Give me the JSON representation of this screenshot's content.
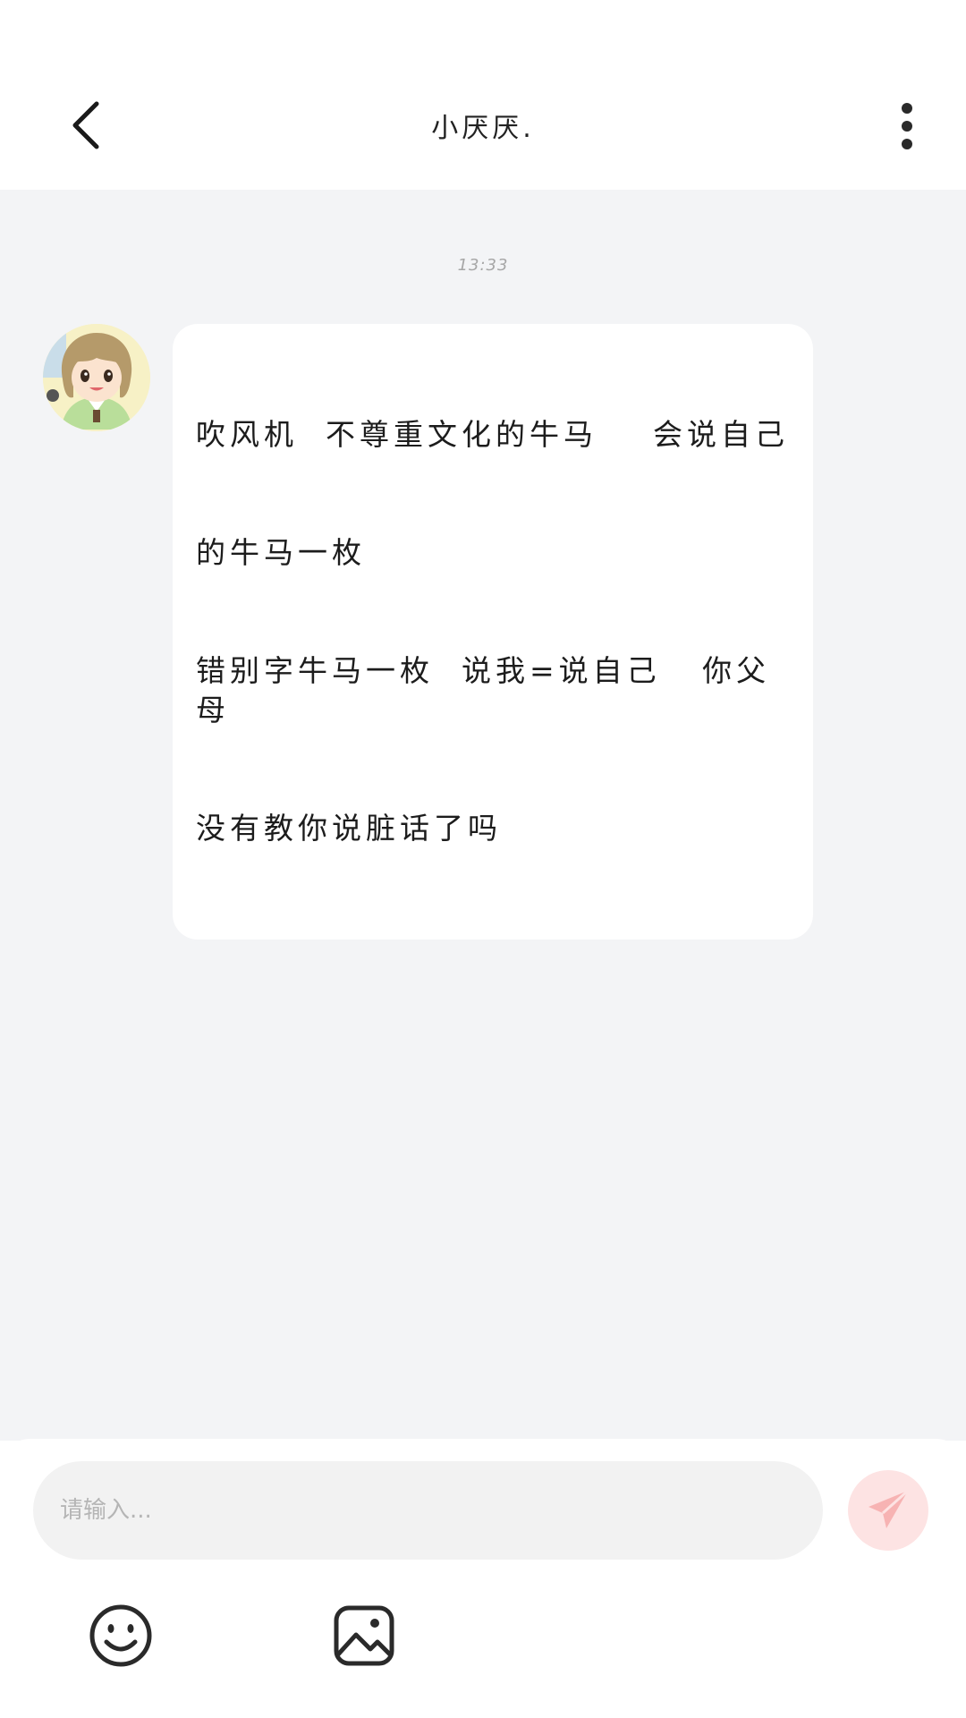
{
  "header": {
    "title": "小厌厌.",
    "back_icon": "chevron-left-icon",
    "more_icon": "more-vertical-icon"
  },
  "chat": {
    "timestamp": "13:33",
    "messages": [
      {
        "sender_avatar": "avatar-anime-girl",
        "lines": [
          "吹风机  不尊重文化的牛马    会说自己",
          "的牛马一枚",
          "错别字牛马一枚  说我=说自己   你父母",
          "没有教你说脏话了吗"
        ]
      }
    ]
  },
  "composer": {
    "placeholder": "请输入...",
    "send_icon": "send-icon",
    "emoji_icon": "emoji-icon",
    "image_icon": "image-icon",
    "send_color": "#fde3e3",
    "send_icon_color": "#f8b4b4"
  }
}
